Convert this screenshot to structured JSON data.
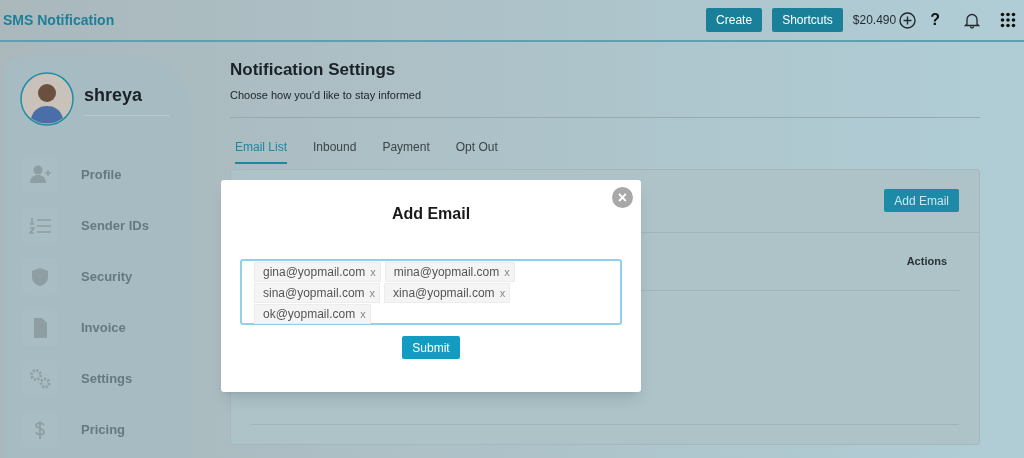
{
  "header": {
    "title": "SMS Notification",
    "buttons": [
      "Create",
      "Shortcuts"
    ],
    "balance": "$20.490",
    "help": "?"
  },
  "sidebar": {
    "user": "shreya",
    "items": [
      {
        "label": "Profile"
      },
      {
        "label": "Sender IDs"
      },
      {
        "label": "Security"
      },
      {
        "label": "Invoice"
      },
      {
        "label": "Settings"
      },
      {
        "label": "Pricing"
      }
    ]
  },
  "page": {
    "title": "Notification Settings",
    "subtitle": "Choose how you'd like to stay informed",
    "tabs": [
      {
        "label": "Email List",
        "selected": true
      },
      {
        "label": "Inbound",
        "selected": false
      },
      {
        "label": "Payment",
        "selected": false
      },
      {
        "label": "Opt Out",
        "selected": false
      }
    ],
    "card": {
      "button": "Add Email",
      "columns": [
        "Actions"
      ]
    }
  },
  "modal": {
    "title": "Add Email",
    "close": "×",
    "emails": [
      {
        "text": "gina@yopmail.com",
        "remove": "x"
      },
      {
        "text": "mina@yopmail.com",
        "remove": "x"
      },
      {
        "text": "sina@yopmail.com",
        "remove": "x"
      },
      {
        "text": "xina@yopmail.com",
        "remove": "x"
      },
      {
        "text": "ok@yopmail.com",
        "remove": "x"
      }
    ],
    "submit": "Submit"
  }
}
